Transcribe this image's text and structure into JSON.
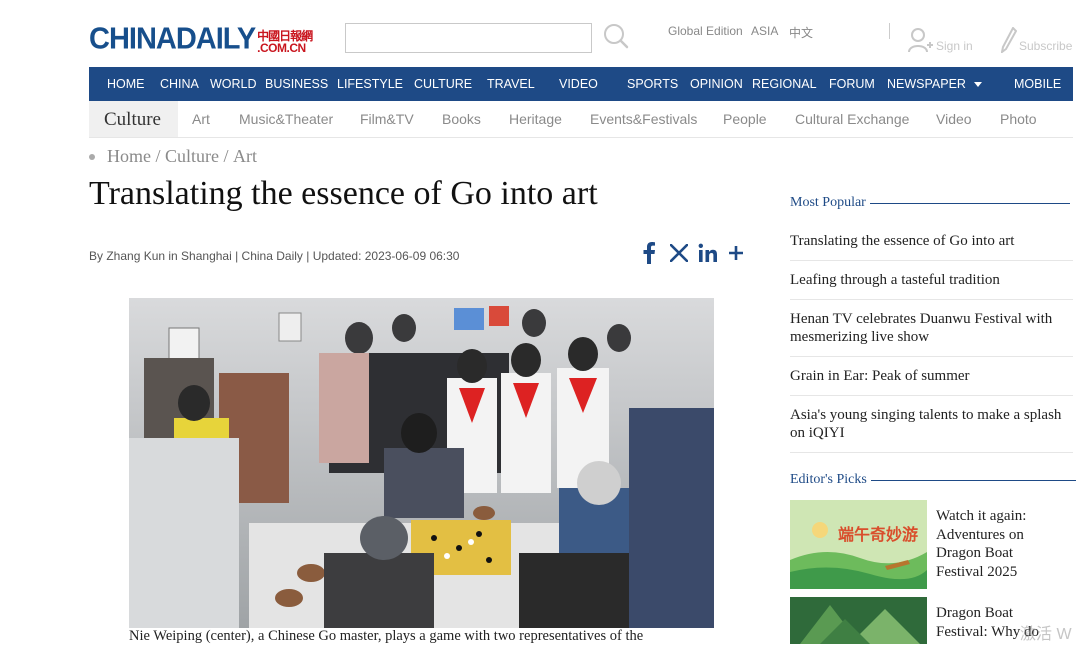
{
  "header": {
    "logo_main": "CHINADAILY",
    "logo_cn": "中國日報網",
    "logo_com": ".COM.CN",
    "edition_links": [
      "Global Edition",
      "ASIA",
      "中文"
    ],
    "sign_in": "Sign in",
    "subscribe": "Subscribe"
  },
  "main_nav": [
    "HOME",
    "CHINA",
    "WORLD",
    "BUSINESS",
    "LIFESTYLE",
    "CULTURE",
    "TRAVEL",
    "VIDEO",
    "SPORTS",
    "OPINION",
    "REGIONAL",
    "FORUM",
    "NEWSPAPER",
    "MOBILE"
  ],
  "sub_nav": {
    "active": "Culture",
    "items": [
      "Art",
      "Music&Theater",
      "Film&TV",
      "Books",
      "Heritage",
      "Events&Festivals",
      "People",
      "Cultural Exchange",
      "Video",
      "Photo"
    ]
  },
  "breadcrumb": {
    "home": "Home",
    "sep": " / ",
    "section": "Culture",
    "sub": "Art"
  },
  "article": {
    "headline": "Translating the essence of Go into art",
    "byline": "By Zhang Kun in Shanghai | China Daily | Updated: 2023-06-09 06:30",
    "caption": "Nie Weiping (center), a Chinese Go master, plays a game with two representatives of the"
  },
  "share_icons": [
    "facebook-icon",
    "x-icon",
    "linkedin-icon",
    "plus-icon"
  ],
  "most_popular": {
    "title": "Most Popular",
    "items": [
      "Translating the essence of Go into art",
      "Leafing through a tasteful tradition",
      "Henan TV celebrates Duanwu Festival with mesmerizing live show",
      "Grain in Ear: Peak of summer",
      "Asia's young singing talents to make a splash on iQIYI"
    ]
  },
  "editors_picks": {
    "title": "Editor's Picks",
    "items": [
      {
        "title": "Watch it again: Adventures on Dragon Boat Festival 2025",
        "thumb_text": "端午奇妙游"
      },
      {
        "title": "Dragon Boat Festival: Why do",
        "thumb_text": ""
      }
    ]
  },
  "watermark": "激活 W",
  "colors": {
    "nav_blue": "#1e4a86",
    "logo_red": "#c9151e"
  }
}
